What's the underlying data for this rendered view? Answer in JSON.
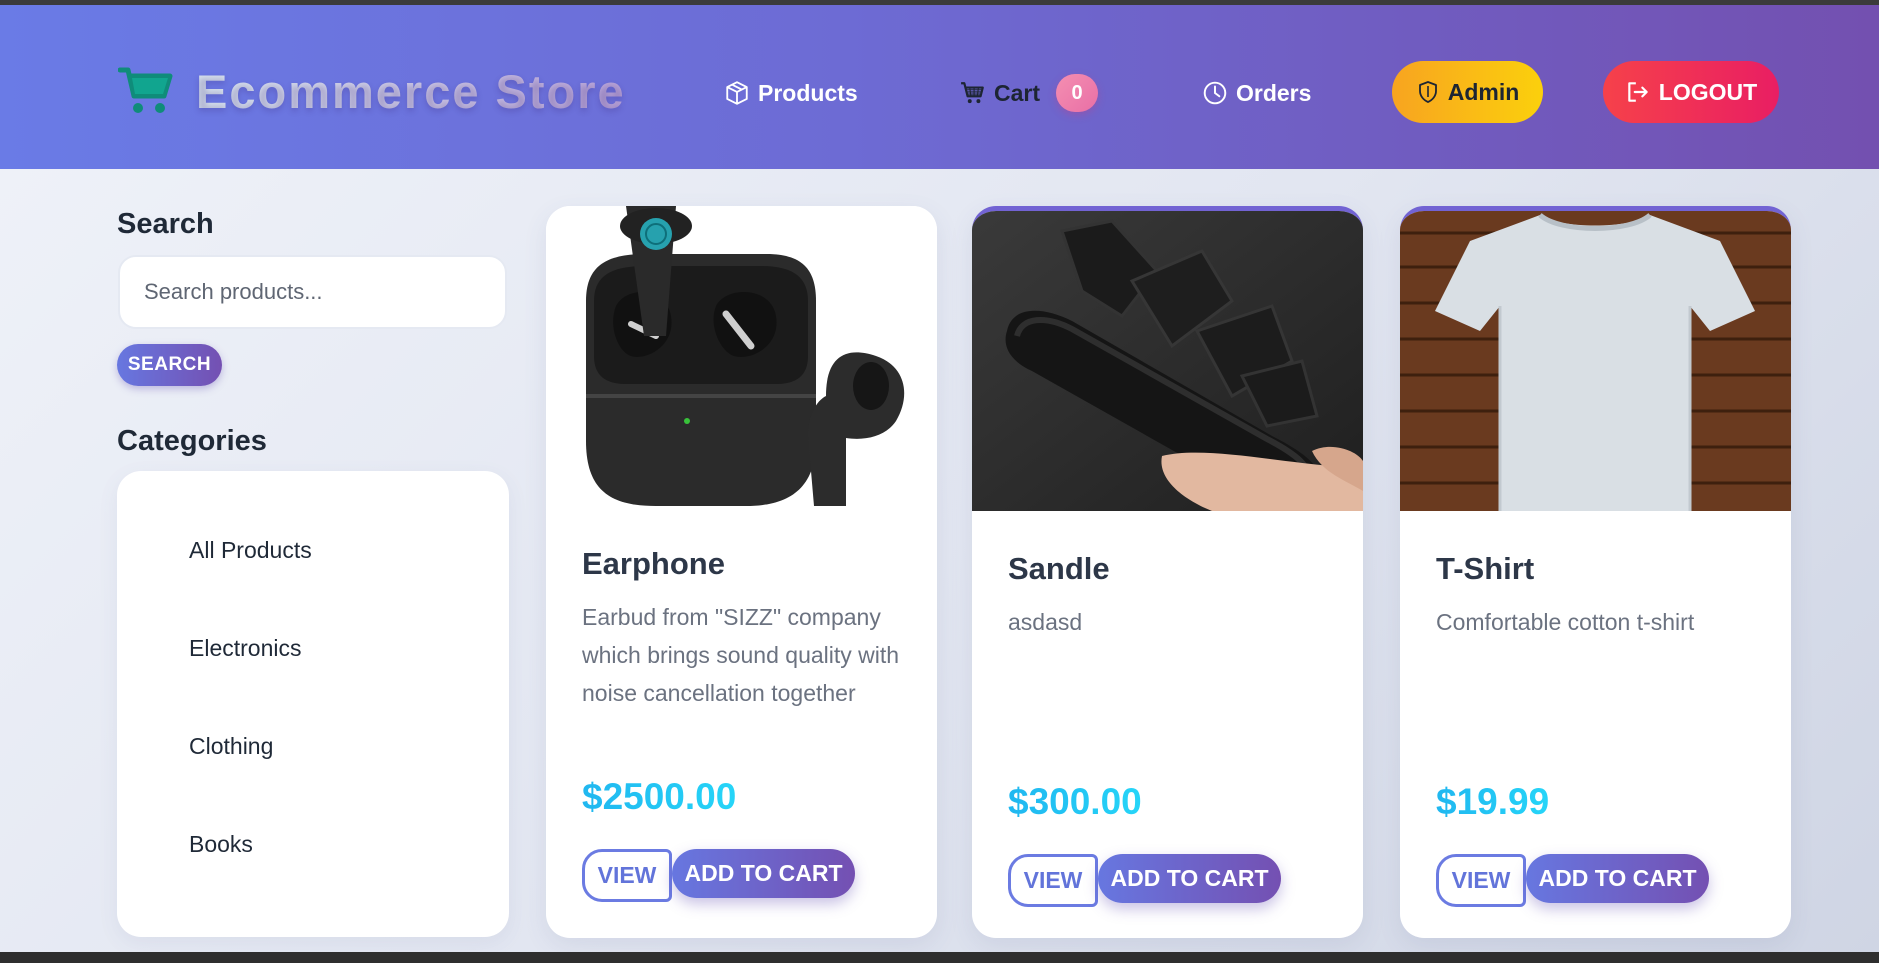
{
  "app": {
    "title": "Ecommerce Store",
    "brand_icon": "shopping-cart-icon"
  },
  "nav": {
    "products_label": "Products",
    "cart_label": "Cart",
    "cart_count": "0",
    "orders_label": "Orders",
    "admin_label": "Admin",
    "logout_label": "LOGOUT"
  },
  "sidebar": {
    "search_heading": "Search",
    "search_placeholder": "Search products...",
    "search_button": "SEARCH",
    "categories_heading": "Categories",
    "categories": [
      {
        "label": "All Products"
      },
      {
        "label": "Electronics"
      },
      {
        "label": "Clothing"
      },
      {
        "label": "Books"
      }
    ]
  },
  "products": [
    {
      "name": "Earphone",
      "description": "Earbud from \"SIZZ\" company which brings sound quality with noise cancellation together",
      "price": "$2500.00",
      "view_label": "VIEW",
      "add_label": "ADD TO CART"
    },
    {
      "name": "Sandle",
      "description": "asdasd",
      "price": "$300.00",
      "view_label": "VIEW",
      "add_label": "ADD TO CART"
    },
    {
      "name": "T-Shirt",
      "description": "Comfortable cotton t-shirt",
      "price": "$19.99",
      "view_label": "VIEW",
      "add_label": "ADD TO CART"
    }
  ],
  "colors": {
    "nav_gradient_start": "#6a7be6",
    "nav_gradient_end": "#7350b0",
    "price": "#20b7f0",
    "admin": "#fbbf24",
    "logout": "#ef4444"
  }
}
